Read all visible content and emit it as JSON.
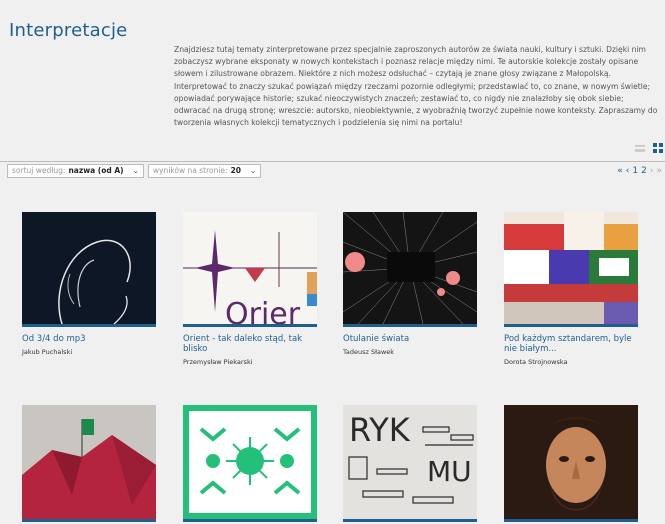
{
  "page": {
    "title": "Interpretacje",
    "intro": "Znajdziesz tutaj tematy zinterpretowane przez specjalnie zaproszonych autorów ze świata nauki, kultury i sztuki. Dzięki nim zobaczysz wybrane eksponaty w nowych kontekstach i poznasz relacje między nimi. Te autorskie kolekcje zostały opisane słowem i zilustrowane obrazem. Niektóre z nich możesz odsłuchać – czytają je znane głosy związane z Małopolską. Interpretować to znaczy szukać powiązań między rzeczami pozornie odległymi; przedstawiać to, co znane, w nowym świetle; opowiadać porywające historie; szukać nieoczywistych znaczeń; zestawiać to, co nigdy nie znalazłoby się obok siebie; odwracać na drugą stronę; wreszcie: autorsko, nieobiektywnie, z wyobraźnią tworzyć zupełnie nowe konteksty. Zapraszamy do tworzenia własnych kolekcji tematycznych i podzielenia się nimi na portalu!"
  },
  "controls": {
    "sort_label": "sortuj według:",
    "sort_value": "nazwa (od A)",
    "per_page_label": "wyników na stronie:",
    "per_page_value": "20"
  },
  "pager": {
    "first": "«",
    "prev": "‹",
    "page1": "1",
    "page2": "2",
    "next": "›",
    "last": "»"
  },
  "cards": [
    {
      "title": "Od 3/4 do mp3",
      "author": "Jakub Puchalski"
    },
    {
      "title": "Orient - tak daleko stąd, tak blisko",
      "author": "Przemysław Piekarski",
      "image_text": "Orier"
    },
    {
      "title": "Otulanie świata",
      "author": "Tadeusz Sławek"
    },
    {
      "title": "Pod każdym sztandarem, byle nie białym...",
      "author": "Dorota Strojnowska"
    },
    {
      "title": "",
      "author": ""
    },
    {
      "title": "",
      "author": ""
    },
    {
      "title": "",
      "author": "",
      "image_text_1": "RYK",
      "image_text_2": "MU"
    },
    {
      "title": "",
      "author": ""
    }
  ],
  "colors": {
    "accent": "#1f5f8f",
    "background": "#f0f0f0"
  }
}
